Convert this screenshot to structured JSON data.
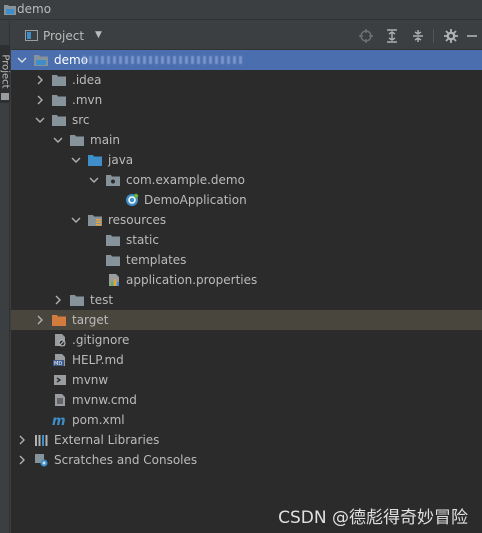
{
  "title_bar": {
    "title": "demo"
  },
  "side_tab": {
    "label": "Project"
  },
  "toolbar": {
    "view_label": "Project",
    "caret": "▼",
    "buttons": [
      "locate-icon",
      "expand-all-icon",
      "collapse-all-icon",
      "settings-icon",
      "hide-icon"
    ]
  },
  "tree": {
    "root": {
      "label": "demo"
    },
    "idea": {
      "label": ".idea"
    },
    "mvn": {
      "label": ".mvn"
    },
    "src": {
      "label": "src"
    },
    "main": {
      "label": "main"
    },
    "java": {
      "label": "java"
    },
    "package": {
      "label": "com.example.demo"
    },
    "demo_app": {
      "label": "DemoApplication"
    },
    "resources": {
      "label": "resources"
    },
    "static": {
      "label": "static"
    },
    "templates": {
      "label": "templates"
    },
    "app_props": {
      "label": "application.properties"
    },
    "test": {
      "label": "test"
    },
    "target": {
      "label": "target"
    },
    "gitignore": {
      "label": ".gitignore"
    },
    "help": {
      "label": "HELP.md"
    },
    "mvnw": {
      "label": "mvnw"
    },
    "mvnw_cmd": {
      "label": "mvnw.cmd"
    },
    "pom": {
      "label": "pom.xml"
    },
    "ext_libs": {
      "label": "External Libraries"
    },
    "scratches": {
      "label": "Scratches and Consoles"
    }
  },
  "colors": {
    "selection": "#4b6eaf",
    "folder": "#87939a",
    "source_folder": "#3d8ec9",
    "excluded_folder": "#d17b3e"
  },
  "watermark": "CSDN @德彪得奇妙冒险"
}
